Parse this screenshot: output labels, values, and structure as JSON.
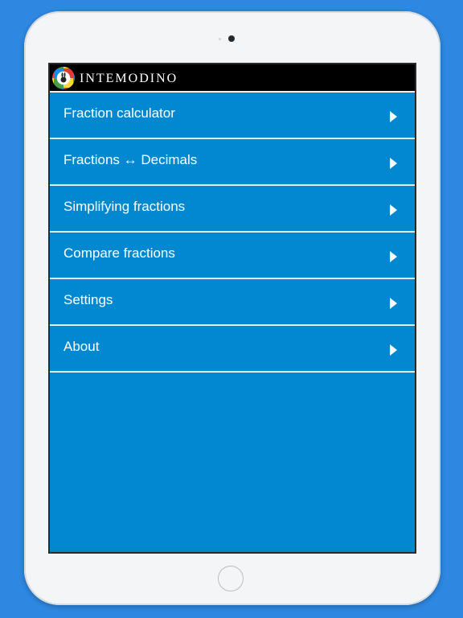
{
  "header": {
    "brand": "INTEMODINO",
    "logo_icon": "rabbit-logo-icon"
  },
  "menu": {
    "items": [
      {
        "label": "Fraction calculator",
        "icon": "chevron-right-icon"
      },
      {
        "label": "Fractions ↔ Decimals",
        "icon": "chevron-right-icon"
      },
      {
        "label": "Simplifying fractions",
        "icon": "chevron-right-icon"
      },
      {
        "label": "Compare fractions",
        "icon": "chevron-right-icon"
      },
      {
        "label": "Settings",
        "icon": "chevron-right-icon"
      },
      {
        "label": "About",
        "icon": "chevron-right-icon"
      }
    ]
  },
  "colors": {
    "background": "#2e87e0",
    "screen": "#0288d1",
    "header": "#000000",
    "text": "#ffffff"
  }
}
